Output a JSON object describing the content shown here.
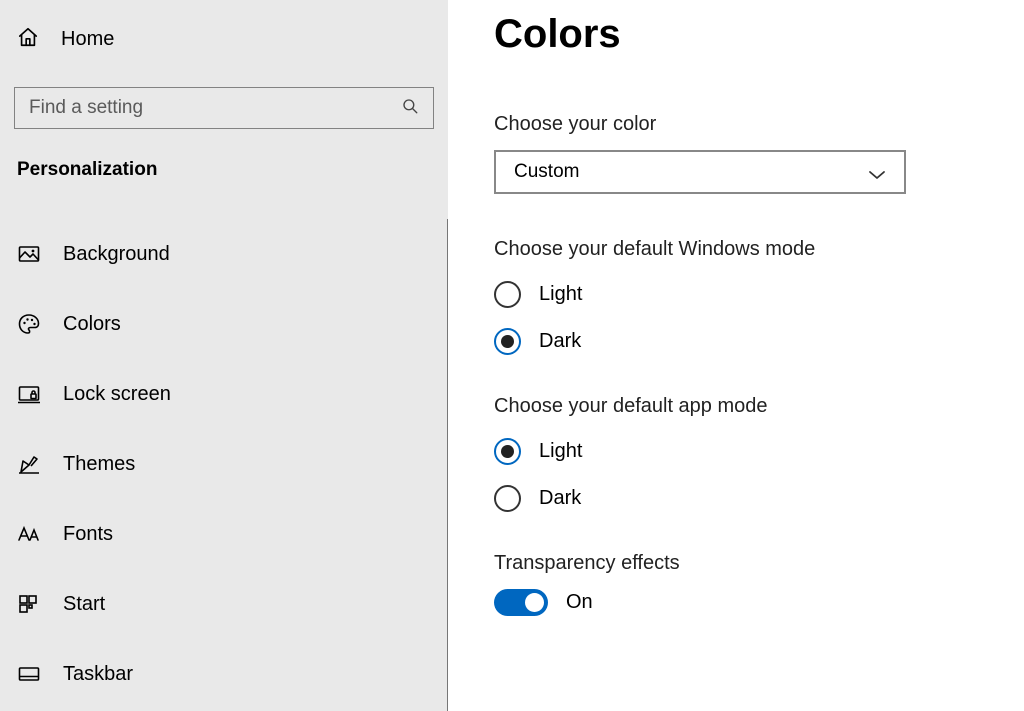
{
  "sidebar": {
    "home": "Home",
    "search_placeholder": "Find a setting",
    "category": "Personalization",
    "items": [
      {
        "label": "Background"
      },
      {
        "label": "Colors"
      },
      {
        "label": "Lock screen"
      },
      {
        "label": "Themes"
      },
      {
        "label": "Fonts"
      },
      {
        "label": "Start"
      },
      {
        "label": "Taskbar"
      }
    ]
  },
  "main": {
    "title": "Colors",
    "choose_color_label": "Choose your color",
    "choose_color_value": "Custom",
    "windows_mode": {
      "label": "Choose your default Windows mode",
      "options": {
        "light": "Light",
        "dark": "Dark"
      },
      "selected": "dark"
    },
    "app_mode": {
      "label": "Choose your default app mode",
      "options": {
        "light": "Light",
        "dark": "Dark"
      },
      "selected": "light"
    },
    "transparency": {
      "label": "Transparency effects",
      "state_label": "On",
      "on": true
    }
  }
}
